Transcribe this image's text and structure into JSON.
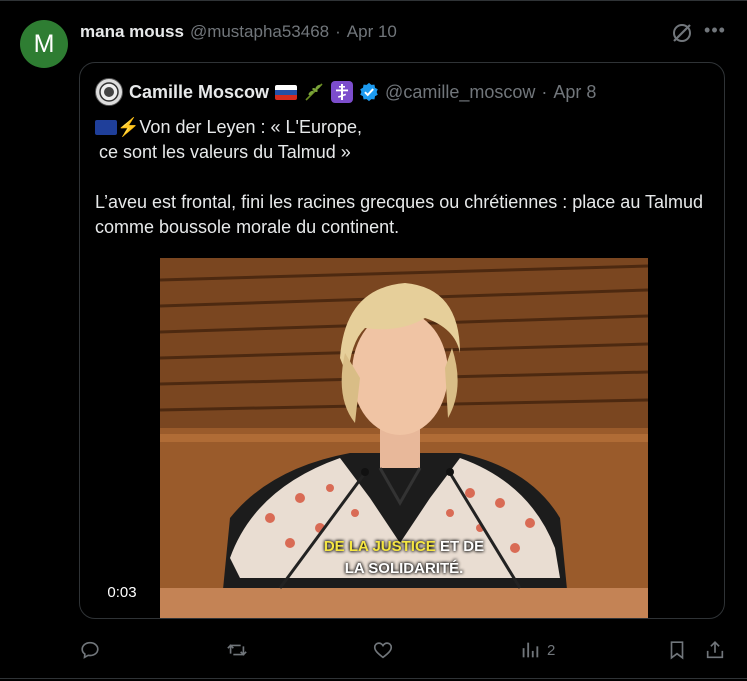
{
  "post": {
    "avatar_letter": "M",
    "author_name": "mana mouss",
    "author_handle": "@mustapha53468",
    "separator": "·",
    "date": "Apr 10"
  },
  "quoted": {
    "author_name": "Camille Moscow",
    "author_handle": "@camille_moscow",
    "separator": "·",
    "date": "Apr 8",
    "line1": "Von der Leyen : « L'Europe,",
    "line2": "ce sont les valeurs du Talmud »",
    "paragraph": "L’aveu est frontal, fini les racines grecques ou chrétiennes : place au Talmud comme boussole morale du continent.",
    "video": {
      "caption_highlight": "DE LA JUSTICE",
      "caption_rest": "ET DE",
      "caption_line2": "LA SOLIDARITÉ.",
      "time": "0:03"
    }
  },
  "actions": {
    "views_count": "2"
  },
  "colors": {
    "background": "#000000",
    "text": "#e7e9ea",
    "muted": "#71767b",
    "border": "#2f3336",
    "verified": "#1d9bf0",
    "avatar": "#2e7d32",
    "caption_highlight": "#f5e642"
  }
}
